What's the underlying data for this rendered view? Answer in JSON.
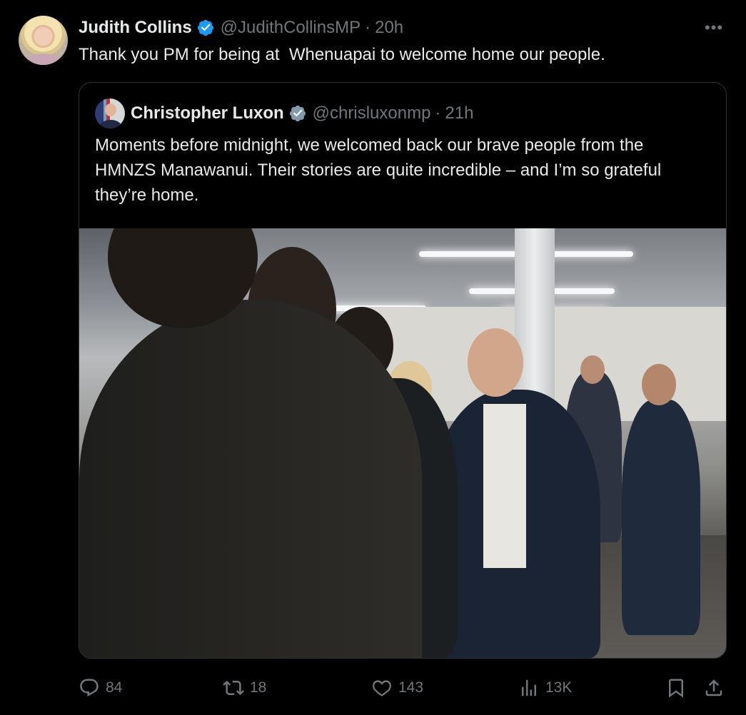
{
  "tweet": {
    "author_name": "Judith Collins",
    "handle": "@JudithCollinsMP",
    "separator": "·",
    "time": "20h",
    "text": "Thank you PM for being at  Whenuapai to welcome home our people.",
    "more_label": "•••"
  },
  "quote": {
    "author_name": "Christopher Luxon",
    "handle": "@chrisluxonmp",
    "separator": "·",
    "time": "21h",
    "text": "Moments before midnight, we welcomed back our brave people from the HMNZS Manawanui. Their stories are quite incredible – and I’m so grateful they’re home.",
    "image_alt": "Photo of people welcoming returning navy personnel in a hall"
  },
  "actions": {
    "replies": "84",
    "reposts": "18",
    "likes": "143",
    "views": "13K"
  },
  "colors": {
    "background": "#000000",
    "text": "#e7e9ea",
    "muted": "#71767b",
    "border": "#2f3336",
    "verified": "#1d9bf0",
    "quote_verified": "#829aab"
  },
  "icons": {
    "verified": "verified-badge-icon",
    "more": "more-icon",
    "reply": "reply-icon",
    "repost": "repost-icon",
    "like": "heart-icon",
    "views": "views-icon",
    "bookmark": "bookmark-icon",
    "share": "share-icon"
  }
}
